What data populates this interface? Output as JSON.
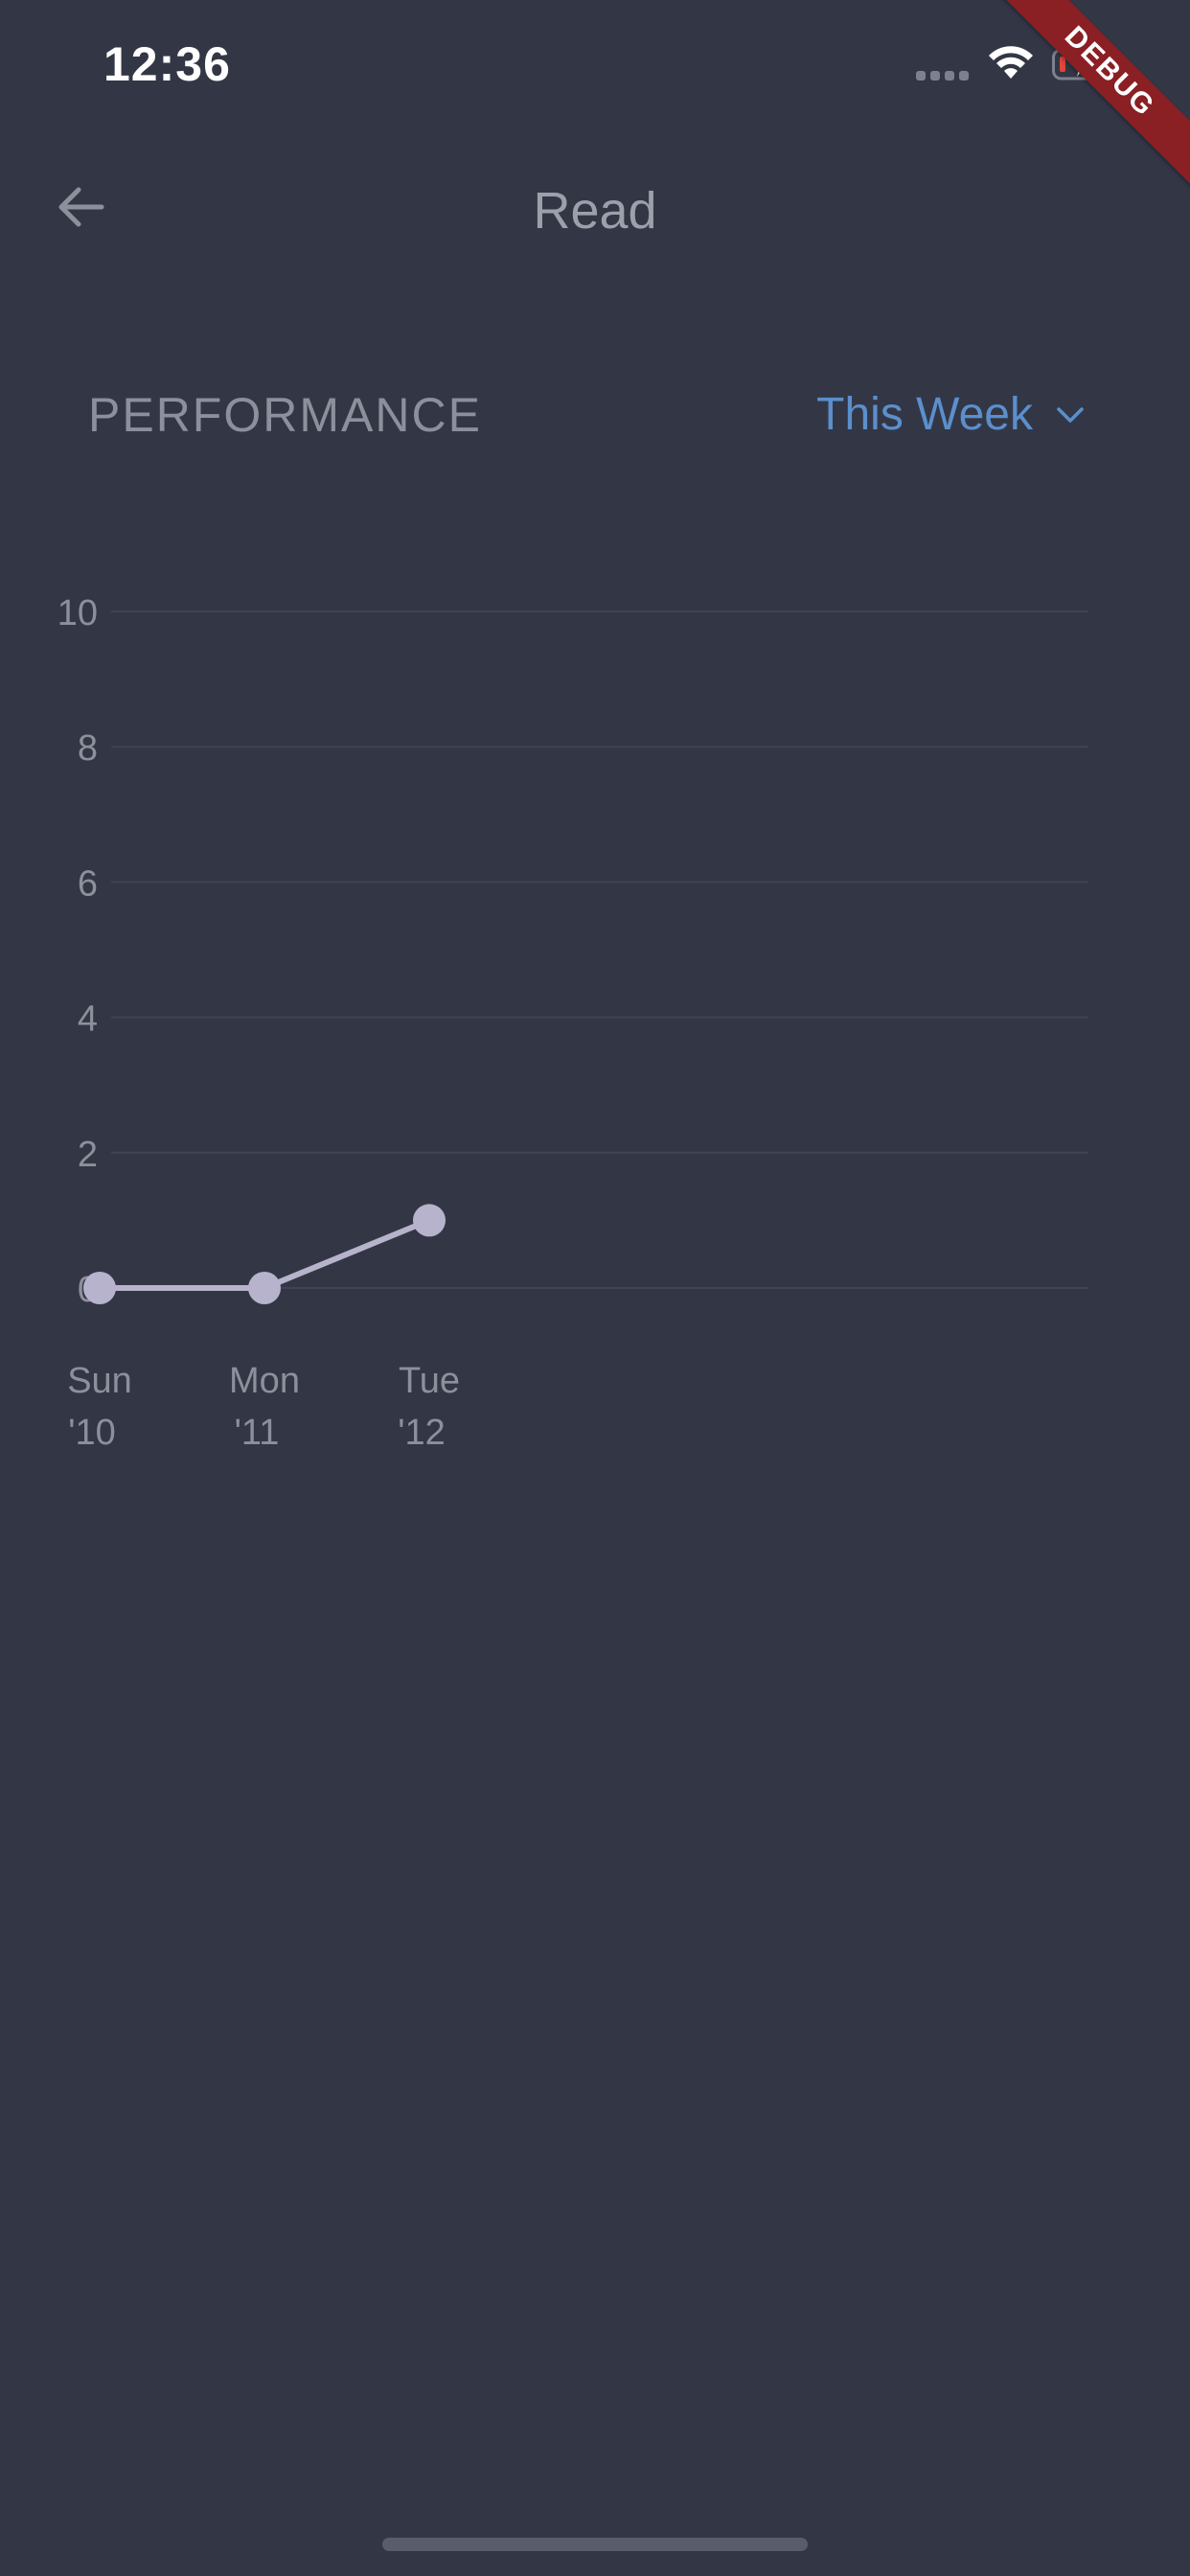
{
  "status_bar": {
    "time": "12:36"
  },
  "debug_banner": "DEBUG",
  "app_bar": {
    "title": "Read",
    "back_icon": "arrow-left-icon"
  },
  "section": {
    "title": "PERFORMANCE",
    "period_label": "This Week",
    "period_icon": "chevron-down-icon"
  },
  "colors": {
    "background": "#333745",
    "accent": "#5b8fcd",
    "line": "#b7b3cc",
    "grid": "#3f4352",
    "muted_text": "#8d909c"
  },
  "chart_data": {
    "type": "line",
    "x": [
      "Sun '10",
      "Mon '11",
      "Tue '12"
    ],
    "x_tick_labels": [
      {
        "line1": "Sun",
        "line2": "'10"
      },
      {
        "line1": "Mon",
        "line2": "'11"
      },
      {
        "line1": "Tue",
        "line2": "'12"
      }
    ],
    "series": [
      {
        "values": [
          0,
          0,
          1
        ]
      }
    ],
    "y_ticks": [
      0,
      2,
      4,
      6,
      8,
      10
    ],
    "ylim": [
      0,
      10
    ],
    "x_slots": 7,
    "grid": true,
    "title": "",
    "xlabel": "",
    "ylabel": ""
  }
}
